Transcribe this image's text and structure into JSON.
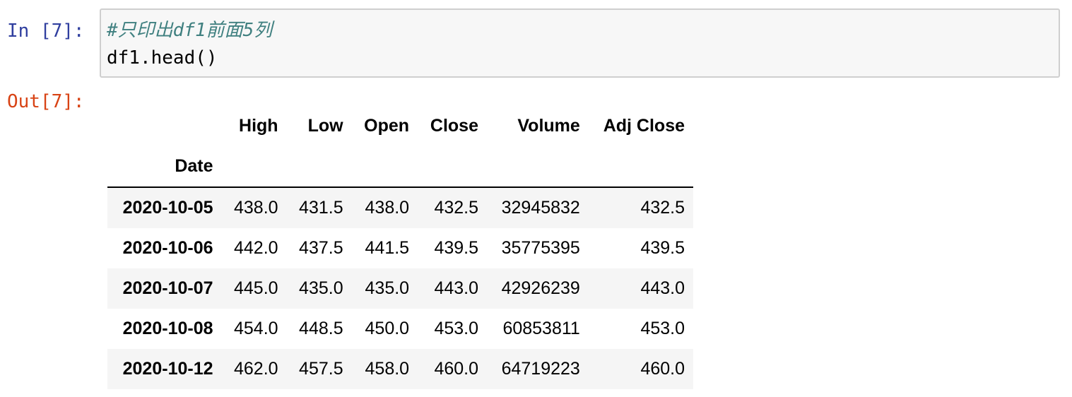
{
  "input_prompt": "In [7]:",
  "output_prompt": "Out[7]:",
  "code": {
    "comment": "#只印出df1前面5列",
    "statement": "df1.head()"
  },
  "dataframe": {
    "columns": [
      "High",
      "Low",
      "Open",
      "Close",
      "Volume",
      "Adj Close"
    ],
    "index_name": "Date",
    "rows": [
      {
        "date": "2020-10-05",
        "values": [
          "438.0",
          "431.5",
          "438.0",
          "432.5",
          "32945832",
          "432.5"
        ]
      },
      {
        "date": "2020-10-06",
        "values": [
          "442.0",
          "437.5",
          "441.5",
          "439.5",
          "35775395",
          "439.5"
        ]
      },
      {
        "date": "2020-10-07",
        "values": [
          "445.0",
          "435.0",
          "435.0",
          "443.0",
          "42926239",
          "443.0"
        ]
      },
      {
        "date": "2020-10-08",
        "values": [
          "454.0",
          "448.5",
          "450.0",
          "453.0",
          "60853811",
          "453.0"
        ]
      },
      {
        "date": "2020-10-12",
        "values": [
          "462.0",
          "457.5",
          "458.0",
          "460.0",
          "64719223",
          "460.0"
        ]
      }
    ]
  },
  "colors": {
    "input_prompt": "#303f9f",
    "output_prompt": "#d84315",
    "comment": "#408080",
    "cell_background": "#f7f7f7",
    "cell_border": "#cfcfcf",
    "striped_row": "#f5f5f5"
  }
}
